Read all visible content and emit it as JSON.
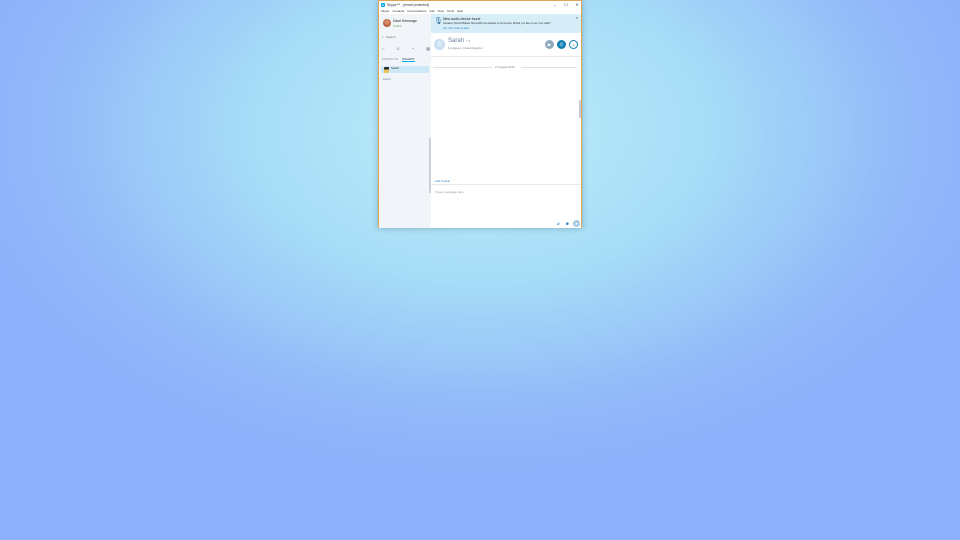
{
  "window": {
    "title": "Skype™ - [email protected]",
    "app_icon": "S",
    "controls": {
      "minimize": "–",
      "maximize": "☐",
      "close": "✕"
    }
  },
  "menu": [
    "Skype",
    "Contacts",
    "Conversations",
    "Call",
    "View",
    "Tools",
    "Help"
  ],
  "profile": {
    "name": "Dave Kimmage",
    "status": "Online"
  },
  "search": {
    "placeholder": "Search"
  },
  "sidebar_icons": [
    "home-icon",
    "contacts-icon",
    "add-contact-icon",
    "dialpad-icon"
  ],
  "tabs": [
    {
      "label": "CONTACTS",
      "active": false
    },
    {
      "label": "RECENT",
      "active": true
    }
  ],
  "recent": [
    {
      "label": "Sarah"
    }
  ],
  "earlier_label": "Earlier",
  "banner": {
    "title": "New audio device found",
    "text": "Speaker (Sound Blaster Recon3D) at Headset is connected. Would you like to use it for calls?",
    "links": "Yes  |  No  |  Ask me later",
    "close": "✕"
  },
  "contact": {
    "name": "Sarah",
    "name_suffix": "˅  ✎",
    "meta": "1 progress, United Kingdom"
  },
  "conversation": {
    "date": "27 August 2015"
  },
  "composer": {
    "link": "Add Trouble",
    "placeholder": "Type a message here"
  },
  "colors": {
    "accent": "#00aff0",
    "call": "#0f7fb1",
    "banner": "#d7eef9",
    "window_border": "#e2a45a"
  }
}
